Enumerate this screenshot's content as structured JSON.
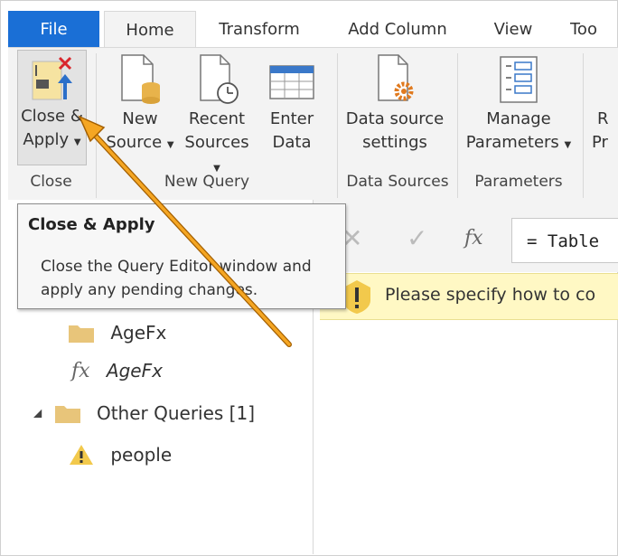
{
  "tabs": [
    "File",
    "Home",
    "Transform",
    "Add Column",
    "View",
    "Too"
  ],
  "ribbon": {
    "close_apply": {
      "line1": "Close &",
      "line2": "Apply"
    },
    "new_source": {
      "line1": "New",
      "line2": "Source"
    },
    "recent_sources": {
      "line1": "Recent",
      "line2": "Sources"
    },
    "enter_data": {
      "line1": "Enter",
      "line2": "Data"
    },
    "data_source_settings": {
      "line1": "Data source",
      "line2": "settings"
    },
    "manage_parameters": {
      "line1": "Manage",
      "line2": "Parameters"
    },
    "cut_right": {
      "line1": "R",
      "line2": "Pr"
    },
    "groups": {
      "close": "Close",
      "new_query": "New Query",
      "data_sources": "Data Sources",
      "parameters": "Parameters"
    }
  },
  "tooltip": {
    "title": "Close & Apply",
    "line1": "Close the Query Editor window and",
    "line2": "apply any pending changes."
  },
  "formula": {
    "fx": "fx",
    "text": "= Table"
  },
  "warning": {
    "text": "Please specify how to co"
  },
  "queries": {
    "folder_agefx": "AgeFx",
    "fn_agefx": "AgeFx",
    "other_queries": "Other Queries [1]",
    "people": "people"
  },
  "colors": {
    "accent": "#1a6fd6",
    "arrow": "#f5a623",
    "warning_bg": "#fff8c4",
    "folder": "#e8c57a"
  }
}
